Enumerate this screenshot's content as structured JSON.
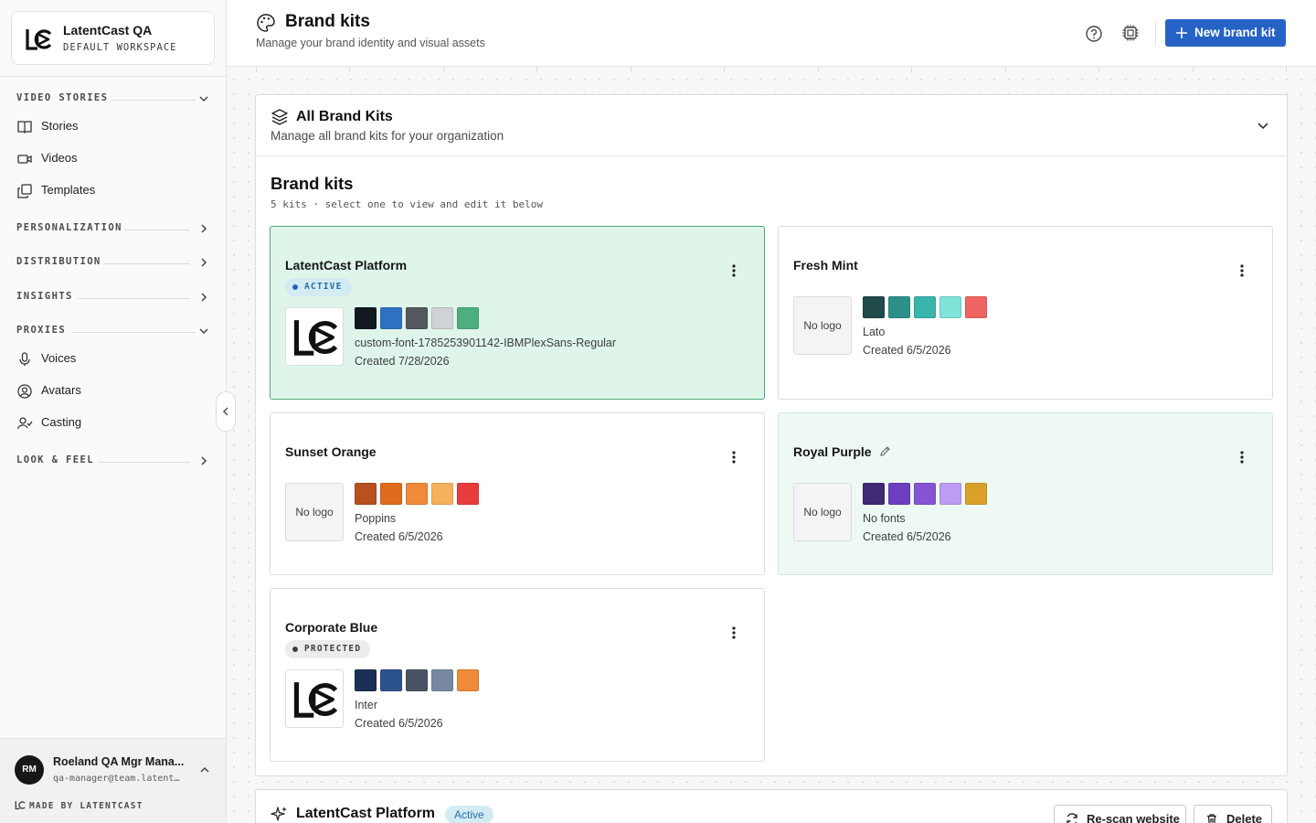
{
  "workspace": {
    "name": "LatentCast QA",
    "subtitle": "DEFAULT WORKSPACE"
  },
  "sidebar": {
    "sections": [
      {
        "label": "VIDEO STORIES",
        "expanded": true
      },
      {
        "label": "PERSONALIZATION",
        "expanded": false
      },
      {
        "label": "DISTRIBUTION",
        "expanded": false
      },
      {
        "label": "INSIGHTS",
        "expanded": false
      },
      {
        "label": "PROXIES",
        "expanded": true
      },
      {
        "label": "LOOK & FEEL",
        "expanded": false
      }
    ],
    "video_items": [
      {
        "label": "Stories",
        "icon": "book-icon"
      },
      {
        "label": "Videos",
        "icon": "video-camera-icon"
      },
      {
        "label": "Templates",
        "icon": "copy-icon"
      }
    ],
    "proxy_items": [
      {
        "label": "Voices",
        "icon": "microphone-icon"
      },
      {
        "label": "Avatars",
        "icon": "user-circle-icon"
      },
      {
        "label": "Casting",
        "icon": "user-check-icon"
      }
    ]
  },
  "user": {
    "initials": "RM",
    "name": "Roeland QA Mgr Mana...",
    "email": "qa-manager@team.latent…",
    "made_by": "MADE BY LATENTCAST"
  },
  "header": {
    "title": "Brand kits",
    "subtitle": "Manage your brand identity and visual assets",
    "new_button": "New brand kit"
  },
  "panel": {
    "title": "All Brand Kits",
    "subtitle": "Manage all brand kits for your organization",
    "section_title": "Brand kits",
    "section_sub": "5 kits · select one to view and edit it below"
  },
  "kits": [
    {
      "name": "LatentCast Platform",
      "badge": "ACTIVE",
      "logo": "latentcast-logo",
      "colors": [
        "#111820",
        "#2f72c4",
        "#54575e",
        "#d1d2d6",
        "#4fae7f"
      ],
      "font": "custom-font-1785253901142-IBMPlexSans-Regular",
      "created": "Created 7/28/2026"
    },
    {
      "name": "Fresh Mint",
      "badge": "",
      "logo": "No logo",
      "colors": [
        "#214a4a",
        "#2d918a",
        "#37b5aa",
        "#7ee3d8",
        "#f06363"
      ],
      "font": "Lato",
      "created": "Created 6/5/2026"
    },
    {
      "name": "Sunset Orange",
      "badge": "",
      "logo": "No logo",
      "colors": [
        "#b8501f",
        "#e06b1f",
        "#ef8a3a",
        "#f7b15c",
        "#e83c3c"
      ],
      "font": "Poppins",
      "created": "Created 6/5/2026"
    },
    {
      "name": "Royal Purple",
      "badge": "",
      "logo": "No logo",
      "colors": [
        "#3f2b73",
        "#6c3fc0",
        "#8454d4",
        "#be9cf3",
        "#d9a12a"
      ],
      "font": "No fonts",
      "created": "Created 6/5/2026"
    },
    {
      "name": "Corporate Blue",
      "badge": "PROTECTED",
      "logo": "latentcast-logo",
      "colors": [
        "#1b2f57",
        "#2c528c",
        "#4a5365",
        "#7988a2",
        "#ef8a3a"
      ],
      "font": "Inter",
      "created": "Created 6/5/2026"
    }
  ],
  "detail": {
    "title": "LatentCast Platform",
    "badge": "Active",
    "rescan_button": "Re-scan website",
    "delete_button": "Delete"
  }
}
